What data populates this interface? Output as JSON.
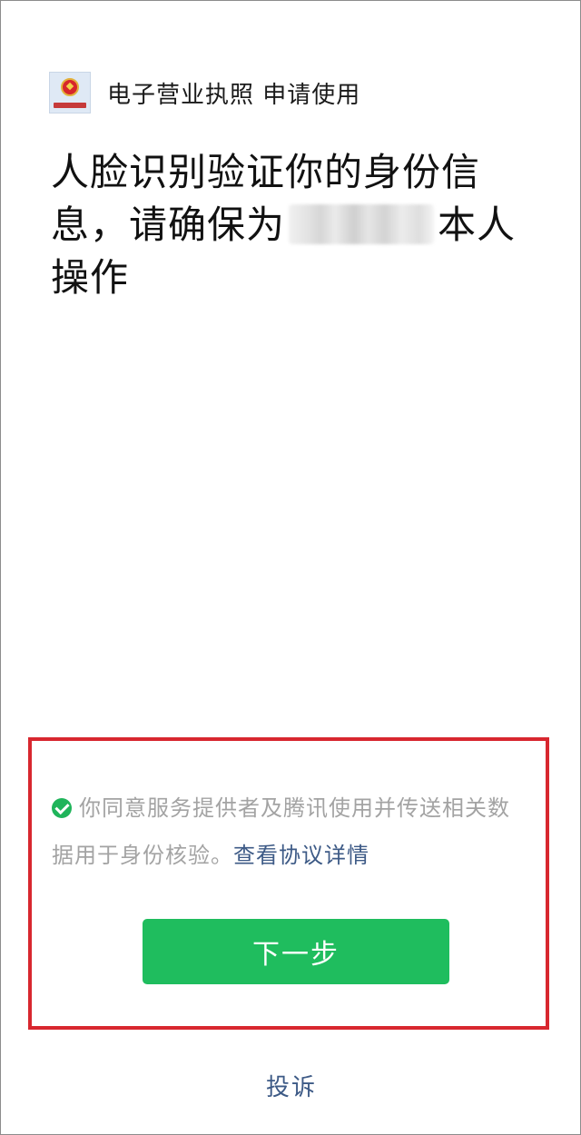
{
  "app": {
    "title": "电子营业执照 申请使用"
  },
  "headline": {
    "part1": "人脸识别验证你的身份信息，请确保为",
    "masked_name": "",
    "part2": "本人操作"
  },
  "consent": {
    "text": "你同意服务提供者及腾讯使用并传送相关数据用于身份核验。",
    "link_label": "查看协议详情"
  },
  "buttons": {
    "next_label": "下一步"
  },
  "footer": {
    "complain_label": "投诉"
  },
  "colors": {
    "primary_green": "#1fbd5e",
    "link_blue": "#3d5a86",
    "highlight_red": "#d8272f"
  }
}
